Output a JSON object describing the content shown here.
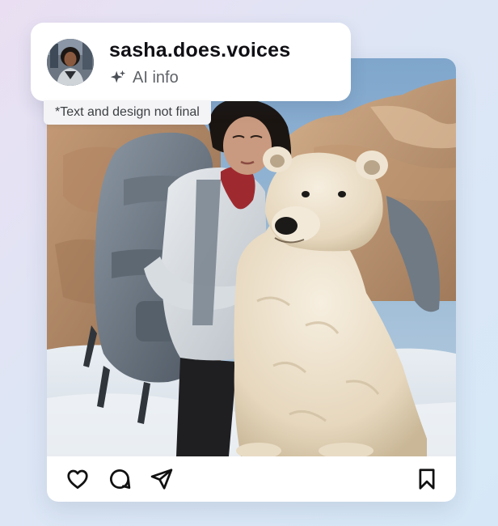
{
  "header": {
    "username": "sasha.does.voices",
    "ai_info_label": "AI info",
    "ai_info_icon": "sparkle-icon",
    "avatar_icon": "avatar"
  },
  "disclaimer": {
    "text": "*Text and design not final"
  },
  "post": {
    "image_alt": "Woman with backpack and polar bear in desert landscape"
  },
  "actions": {
    "like_icon": "heart-icon",
    "comment_icon": "comment-icon",
    "share_icon": "send-icon",
    "save_icon": "bookmark-icon"
  },
  "colors": {
    "background_start": "#eadff2",
    "background_end": "#d6e8f7",
    "card": "#ffffff",
    "text_primary": "#0f0f14",
    "text_secondary": "#5f6368"
  }
}
